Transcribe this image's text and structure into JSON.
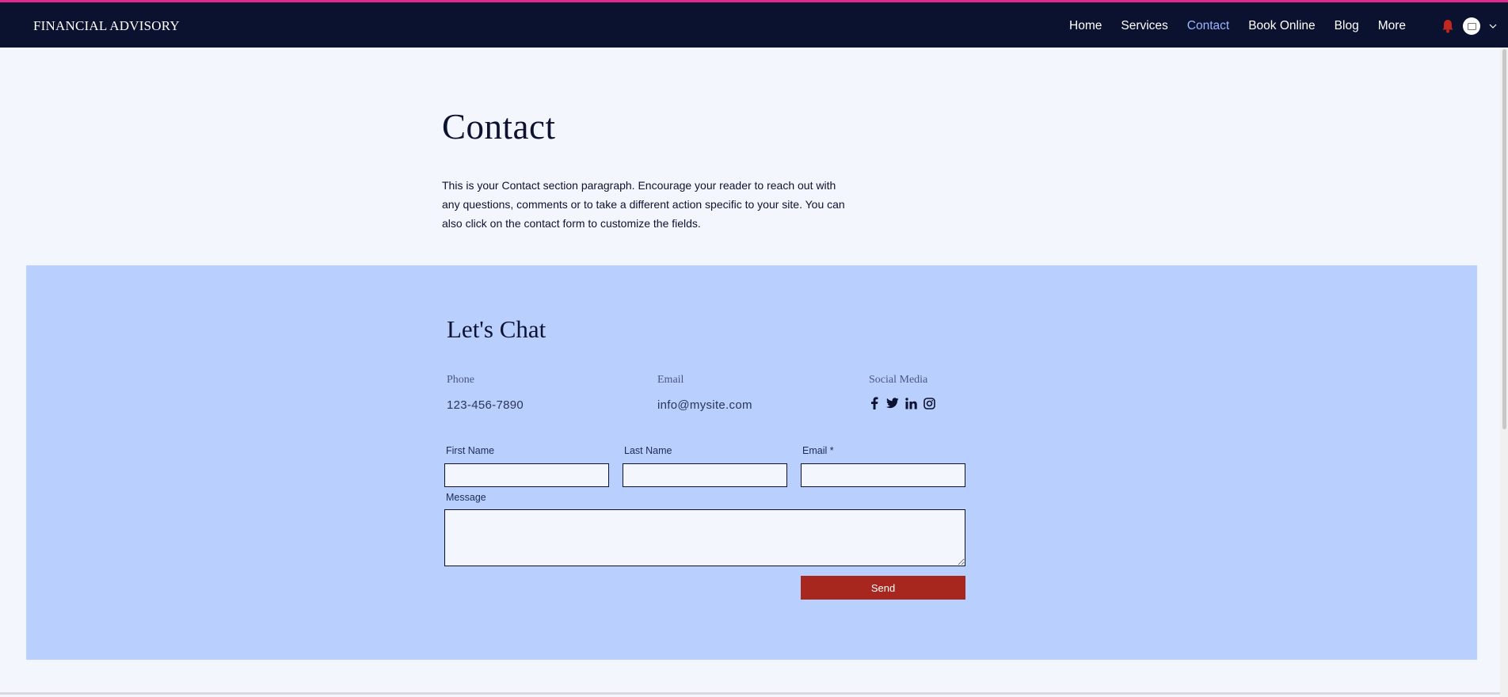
{
  "header": {
    "brand": "FINANCIAL ADVISORY",
    "nav": [
      {
        "label": "Home"
      },
      {
        "label": "Services"
      },
      {
        "label": "Contact",
        "active": true
      },
      {
        "label": "Book Online"
      },
      {
        "label": "Blog"
      },
      {
        "label": "More"
      }
    ],
    "icons": [
      "bell-icon",
      "avatar",
      "chevron-down-icon"
    ],
    "colors": {
      "background": "#0b1230",
      "accent_bar": "#e0288e",
      "active_link": "#9bb6ff",
      "bell": "#c0271e"
    }
  },
  "main": {
    "title": "Contact",
    "intro_lines": [
      "This is your Contact section paragraph. Encourage your reader to reach out with",
      "any questions, comments or to take a different action specific to your site. You can",
      "also click on the contact form to customize the fields."
    ]
  },
  "chat": {
    "title": "Let's Chat",
    "phone": {
      "label": "Phone",
      "value": "123-456-7890"
    },
    "email": {
      "label": "Email",
      "value": "info@mysite.com"
    },
    "social": {
      "label": "Social Media",
      "icons": [
        "facebook-icon",
        "twitter-icon",
        "linkedin-icon",
        "instagram-icon"
      ]
    },
    "form": {
      "first_name_label": "First Name",
      "last_name_label": "Last Name",
      "email_label": "Email *",
      "message_label": "Message",
      "first_name_value": "",
      "last_name_value": "",
      "email_value": "",
      "message_value": "",
      "send_label": "Send"
    },
    "colors": {
      "section_bg": "#b9cffd",
      "send_button": "#a7271f"
    }
  }
}
